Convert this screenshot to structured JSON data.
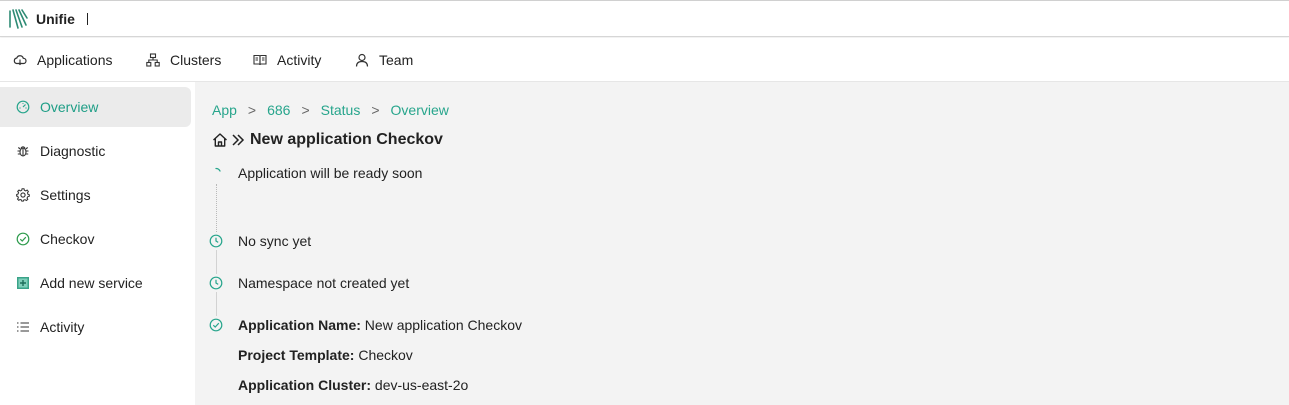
{
  "app": {
    "brand": "Unifie",
    "accent": "#27a58c"
  },
  "nav": [
    {
      "label": "Applications",
      "icon": "cloud-icon"
    },
    {
      "label": "Clusters",
      "icon": "network-icon"
    },
    {
      "label": "Activity",
      "icon": "book-icon"
    },
    {
      "label": "Team",
      "icon": "user-icon"
    }
  ],
  "sidebar": {
    "items": [
      {
        "label": "Overview",
        "icon": "dashboard-icon",
        "active": true
      },
      {
        "label": "Diagnostic",
        "icon": "bug-icon"
      },
      {
        "label": "Settings",
        "icon": "gear-icon"
      },
      {
        "label": "Checkov",
        "icon": "check-circle-icon"
      },
      {
        "label": "Add new service",
        "icon": "plus-square-icon"
      },
      {
        "label": "Activity",
        "icon": "list-icon"
      }
    ]
  },
  "breadcrumb": {
    "items": [
      "App",
      "686",
      "Status",
      "Overview"
    ],
    "separator": ">"
  },
  "page": {
    "title": "New application Checkov"
  },
  "status": {
    "steps": [
      {
        "text": "Application will be ready soon",
        "icon": "spinner-icon"
      },
      {
        "text": "No sync yet",
        "icon": "clock-icon"
      },
      {
        "text": "Namespace not created yet",
        "icon": "clock-icon"
      }
    ],
    "details": [
      {
        "label": "Application Name:",
        "value": "New application Checkov"
      },
      {
        "label": "Project Template:",
        "value": "Checkov"
      },
      {
        "label": "Application Cluster:",
        "value": "dev-us-east-2o"
      }
    ]
  }
}
